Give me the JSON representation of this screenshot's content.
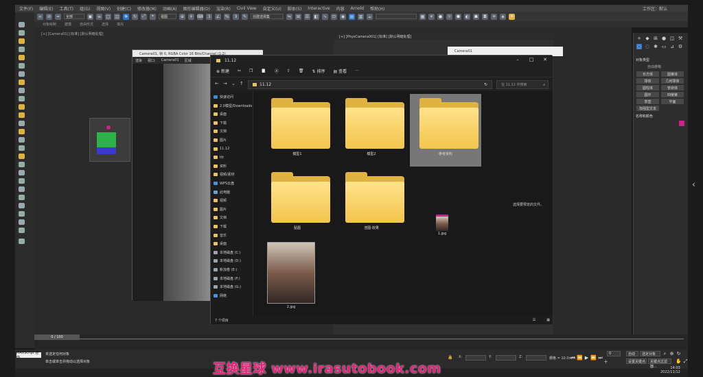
{
  "menubar": {
    "items": [
      "文件(F)",
      "编辑(E)",
      "工具(T)",
      "组(G)",
      "视图(V)",
      "创建(C)",
      "修改器(M)",
      "动画(A)",
      "图形编辑器(D)",
      "渲染(R)",
      "Civil View",
      "自定义(U)",
      "脚本(S)",
      "Interactive",
      "内容",
      "Arnold",
      "帮助(H)"
    ],
    "workspace": "工作区：默认"
  },
  "toolbar": {
    "selection_filter": "全部",
    "view": "视图",
    "selection_set": "创建选择集"
  },
  "cmd_strip": {
    "items": [
      "对象绘制",
      "建模",
      "自由形式",
      "选择",
      "填充"
    ]
  },
  "viewport": {
    "label": "[+] [Camera01] [标准] [默认明暗处理]"
  },
  "render_window": {
    "title": "Camera01, 帧 0, RGBA Color 16 Bits/Channel (1:2)",
    "toolbar_items": [
      "渲染",
      "视口:",
      "Camera01",
      "区域"
    ]
  },
  "camera_window": {
    "title": "[+] [PhysCamera001] [标准] [默认明暗处理]",
    "second_title": "Camera01"
  },
  "explorer": {
    "title": "11.12",
    "new_label": "新建",
    "sort_label": "排序",
    "view_label": "查看",
    "more_label": "···",
    "path": "11.12",
    "search_placeholder": "在 11.12 中搜索",
    "nav_items": [
      {
        "label": "快速访问"
      },
      {
        "label": "2.0模型/Downloads"
      },
      {
        "label": "桌面"
      },
      {
        "label": "下载"
      },
      {
        "label": "文档"
      },
      {
        "label": "图片"
      },
      {
        "label": "11.12"
      },
      {
        "label": "ttt"
      },
      {
        "label": "资料"
      },
      {
        "label": "视频/素材"
      },
      {
        "label": "WPS云盘"
      },
      {
        "label": "此电脑"
      },
      {
        "label": "视频"
      },
      {
        "label": "图片"
      },
      {
        "label": "文档"
      },
      {
        "label": "下载"
      },
      {
        "label": "音乐"
      },
      {
        "label": "桌面"
      },
      {
        "label": "本地磁盘 (C:)"
      },
      {
        "label": "本地磁盘 (D:)"
      },
      {
        "label": "新加卷 (E:)"
      },
      {
        "label": "本地磁盘 (F:)"
      },
      {
        "label": "本地磁盘 (G:)"
      },
      {
        "label": "网络"
      }
    ],
    "folders": [
      {
        "label": "模型1"
      },
      {
        "label": "模型2"
      },
      {
        "label": "参考资料"
      },
      {
        "label": "贴图"
      },
      {
        "label": "渲图-效果"
      }
    ],
    "files": [
      {
        "label": "1.jpg"
      },
      {
        "label": "2.jpg"
      }
    ],
    "empty_message": "选择要预览的文件。",
    "status": "7 个项目"
  },
  "right_panel": {
    "section1": "对象类型",
    "autogrid": "自动栅格",
    "buttons": [
      "长方体",
      "圆锥体",
      "球体",
      "几何球体",
      "圆柱体",
      "管状体",
      "圆环",
      "四棱锥",
      "茶壶",
      "平面",
      "加强型文本"
    ],
    "section2": "名称和颜色",
    "accent": "#d0208a"
  },
  "timeline": {
    "slider": "0 / 100"
  },
  "status": {
    "maxscript": "MAXScript 迷你",
    "line1": "未选定任何对象",
    "line2": "单击或单击并拖动以选择对象",
    "frame": "0",
    "x_label": "X:",
    "y_label": "Y:",
    "z_label": "Z:",
    "grid": "栅格 = 10.0mm",
    "autokey": "自动",
    "selection": "选定对象",
    "setkey": "设置关键点",
    "filters": "关键点过滤器..."
  },
  "clock": {
    "time": "14:03",
    "date": "2022/11/12"
  },
  "watermark": "互换星球 www.irasutobook.com"
}
